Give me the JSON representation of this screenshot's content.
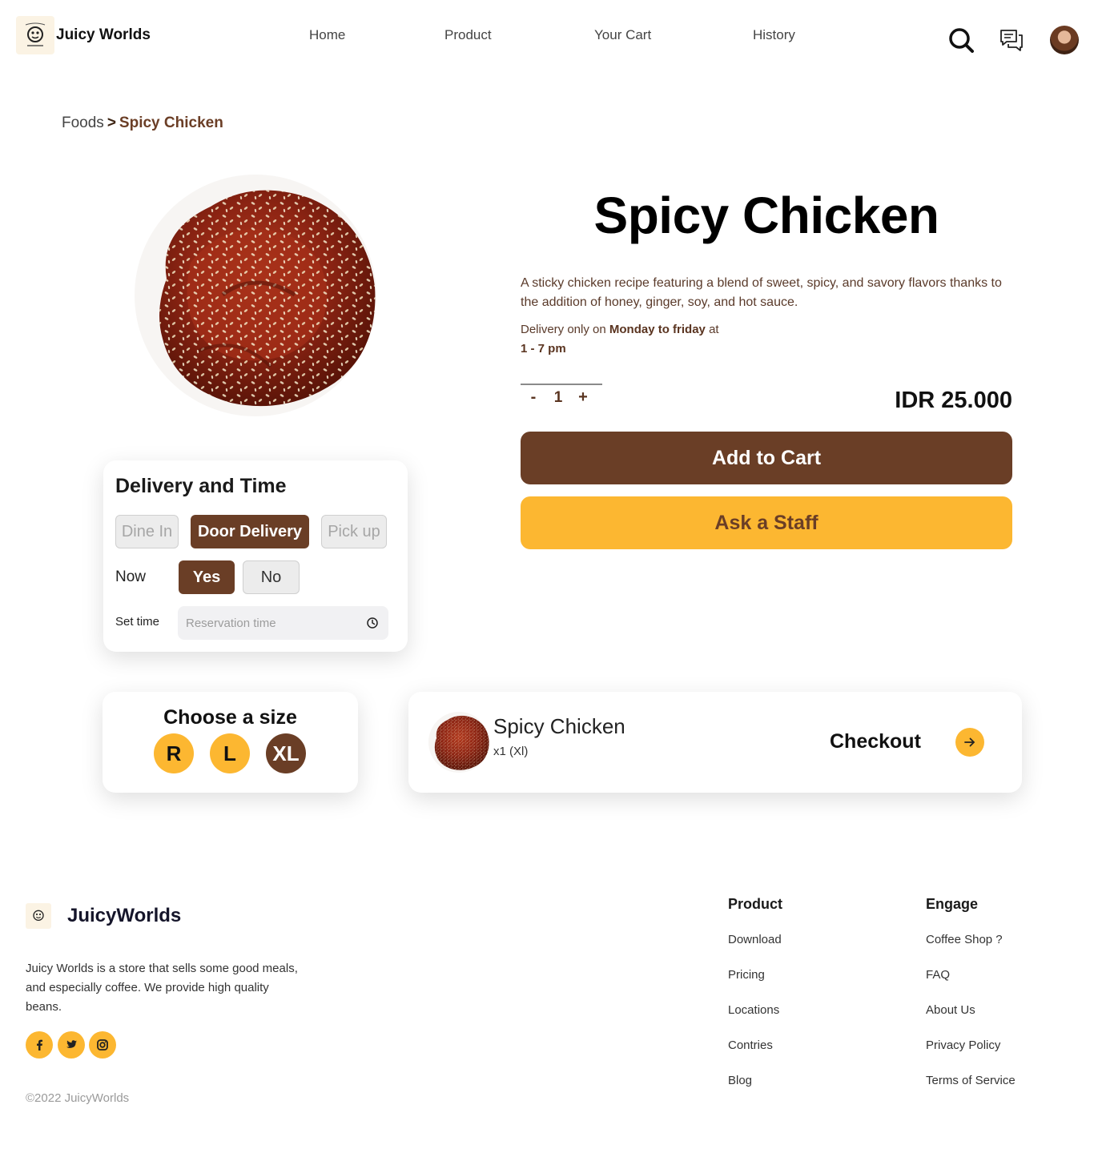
{
  "header": {
    "brand": "Juicy Worlds",
    "nav": [
      "Home",
      "Product",
      "Your Cart",
      "History"
    ],
    "icons": [
      "search-icon",
      "chat-icon",
      "avatar"
    ]
  },
  "breadcrumb": {
    "parent": "Foods",
    "separator": ">",
    "current": "Spicy Chicken"
  },
  "product": {
    "title": "Spicy Chicken",
    "description": "A sticky chicken recipe featuring a blend of sweet, spicy, and savory flavors thanks to the addition of honey, ginger, soy, and hot sauce.",
    "delivery_prefix": "Delivery only on",
    "delivery_days": "Monday to friday",
    "delivery_at": "at",
    "delivery_hours": "1 - 7 pm",
    "quantity": {
      "minus": "-",
      "value": "1",
      "plus": "+"
    },
    "price": "IDR 25.000",
    "add_to_cart": "Add to Cart",
    "ask_staff": "Ask a Staff"
  },
  "delivery_card": {
    "title": "Delivery and Time",
    "options": [
      "Dine In",
      "Door Delivery",
      "Pick up"
    ],
    "selected_option": "Door Delivery",
    "now_label": "Now",
    "yes": "Yes",
    "no": "No",
    "now_selected": "Yes",
    "set_time_label": "Set time",
    "time_placeholder": "Reservation time"
  },
  "size_card": {
    "title": "Choose a size",
    "sizes": [
      "R",
      "L",
      "XL"
    ],
    "selected": "XL"
  },
  "checkout_card": {
    "item_name": "Spicy Chicken",
    "item_qty": "x1 (Xl)",
    "label": "Checkout"
  },
  "footer": {
    "brand": "JuicyWorlds",
    "description": "Juicy Worlds is a store that sells some good meals, and especially coffee. We provide high quality beans.",
    "social": [
      "facebook-icon",
      "twitter-icon",
      "instagram-icon"
    ],
    "copyright": "©2022 JuicyWorlds",
    "product_col": {
      "title": "Product",
      "links": [
        "Download",
        "Pricing",
        "Locations",
        "Contries",
        "Blog"
      ]
    },
    "engage_col": {
      "title": "Engage",
      "links": [
        "Coffee Shop ?",
        "FAQ",
        "About Us",
        "Privacy Policy",
        "Terms of Service"
      ]
    }
  },
  "colors": {
    "brown": "#6a3e26",
    "yellow": "#fcb731",
    "text_brown": "#5a3a2a"
  }
}
